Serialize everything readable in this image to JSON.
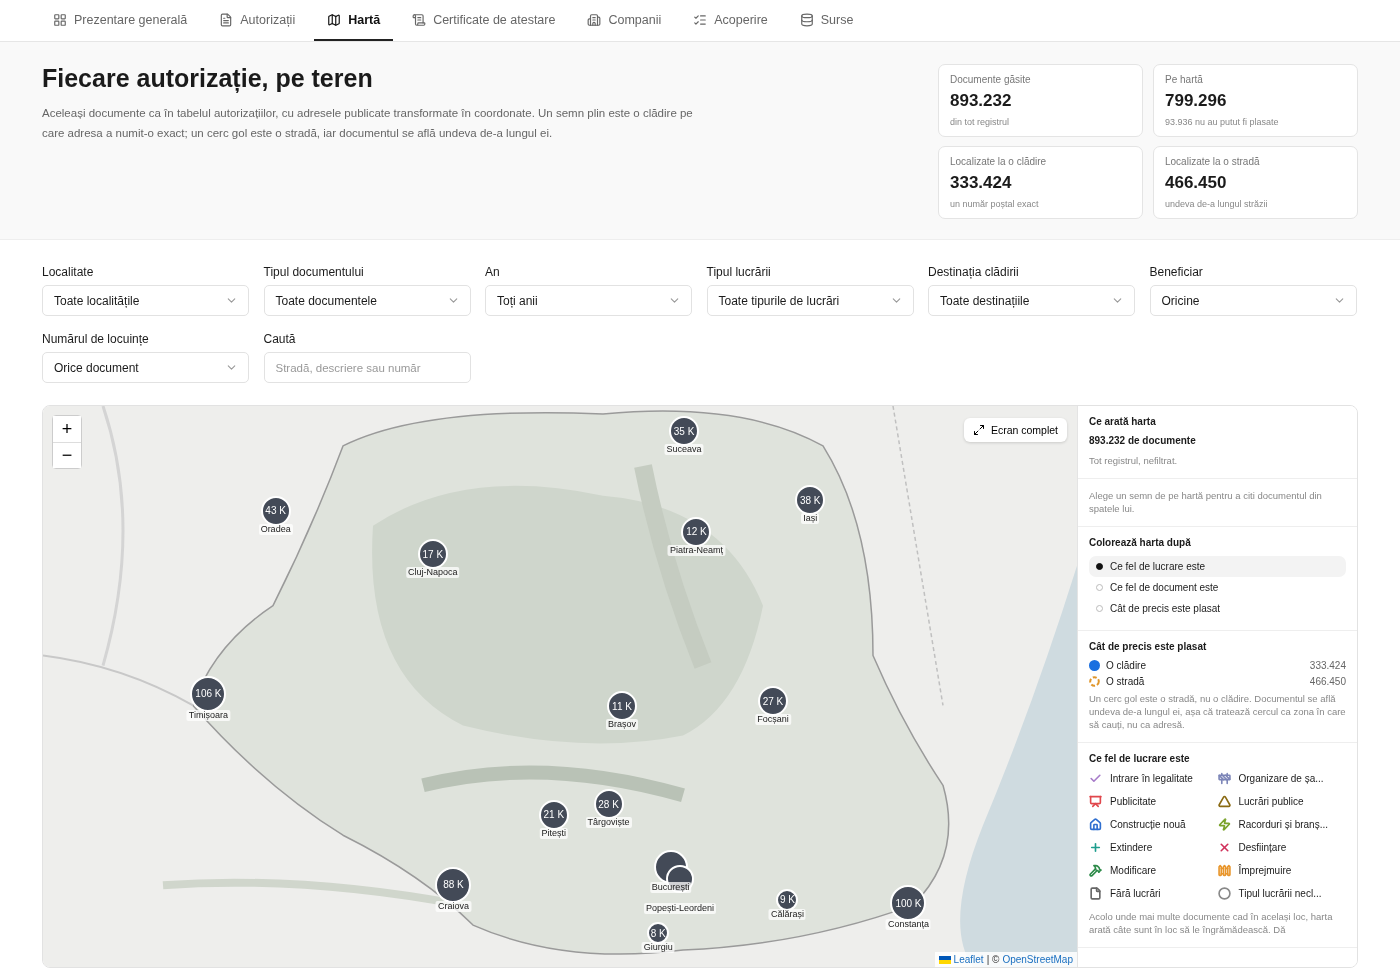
{
  "nav": [
    {
      "label": "Prezentare generală",
      "selected": false
    },
    {
      "label": "Autorizații",
      "selected": false
    },
    {
      "label": "Hartă",
      "selected": true
    },
    {
      "label": "Certificate de atestare",
      "selected": false
    },
    {
      "label": "Companii",
      "selected": false
    },
    {
      "label": "Acoperire",
      "selected": false
    },
    {
      "label": "Surse",
      "selected": false
    }
  ],
  "header": {
    "title": "Fiecare autorizație, pe teren",
    "description": "Aceleași documente ca în tabelul autorizațiilor, cu adresele publicate transformate în coordonate. Un semn plin este o clădire pe care adresa a numit-o exact; un cerc gol este o stradă, iar documentul se află undeva de-a lungul ei."
  },
  "stats": [
    {
      "label": "Documente găsite",
      "value": "893.232",
      "note": "din tot registrul"
    },
    {
      "label": "Pe hartă",
      "value": "799.296",
      "note": "93.936 nu au putut fi plasate"
    },
    {
      "label": "Localizate la o clădire",
      "value": "333.424",
      "note": "un număr poștal exact"
    },
    {
      "label": "Localizate la o stradă",
      "value": "466.450",
      "note": "undeva de-a lungul străzii"
    }
  ],
  "filters": [
    {
      "kind": "select",
      "label": "Localitate",
      "value": "Toate localitățile"
    },
    {
      "kind": "select",
      "label": "Tipul documentului",
      "value": "Toate documentele"
    },
    {
      "kind": "select",
      "label": "An",
      "value": "Toți anii"
    },
    {
      "kind": "select",
      "label": "Tipul lucrării",
      "value": "Toate tipurile de lucrări"
    },
    {
      "kind": "select",
      "label": "Destinația clădirii",
      "value": "Toate destinațiile"
    },
    {
      "kind": "select",
      "label": "Beneficiar",
      "value": "Oricine"
    },
    {
      "kind": "select",
      "label": "Numărul de locuințe",
      "value": "Orice document"
    },
    {
      "kind": "search",
      "label": "Caută",
      "placeholder": "Stradă, descriere sau număr"
    }
  ],
  "map": {
    "zoom_in": "+",
    "zoom_out": "−",
    "fullscreen": "Ecran complet",
    "attribution_leaflet": "Leaflet",
    "attribution_sep": "| ©",
    "attribution_osm": "OpenStreetMap",
    "clusters": [
      {
        "count": "35 K",
        "city": "Suceava"
      },
      {
        "count": "38 K",
        "city": "Iași"
      },
      {
        "count": "43 K",
        "city": "Oradea"
      },
      {
        "count": "17 K",
        "city": "Cluj-Napoca"
      },
      {
        "count": "12 K",
        "city": "Piatra-Neamț"
      },
      {
        "count": "106 K",
        "city": "Timișoara"
      },
      {
        "count": "11 K",
        "city": "Brașov"
      },
      {
        "count": "27 K",
        "city": "Focșani"
      },
      {
        "count": "21 K",
        "city": "Pitești"
      },
      {
        "count": "28 K",
        "city": "Târgoviște"
      },
      {
        "count": "88 K",
        "city": "Craiova"
      },
      {
        "city": "București"
      },
      {
        "city": "Popești-Leordeni"
      },
      {
        "count": "9 K",
        "city": "Călărași"
      },
      {
        "count": "100 K",
        "city": "Constanța"
      },
      {
        "count": "8 K",
        "city": "Giurgiu"
      }
    ]
  },
  "panel": {
    "title": "Ce arată harta",
    "count": "893.232 de documente",
    "scope": "Tot registrul, nefiltrat.",
    "hint": "Alege un semn de pe hartă pentru a citi documentul din spatele lui.",
    "color_by": {
      "title": "Colorează harta după",
      "options": [
        {
          "label": "Ce fel de lucrare este",
          "selected": true
        },
        {
          "label": "Ce fel de document este",
          "selected": false
        },
        {
          "label": "Cât de precis este plasat",
          "selected": false
        }
      ]
    },
    "precision": {
      "title": "Cât de precis este plasat",
      "items": [
        {
          "kind": "filled",
          "label": "O clădire",
          "value": "333.424",
          "color": "#1a6fe0"
        },
        {
          "kind": "ring",
          "label": "O stradă",
          "value": "466.450",
          "color": "#e0962a"
        }
      ],
      "note": "Un cerc gol este o stradă, nu o clădire. Documentul se află undeva de-a lungul ei, așa că tratează cercul ca zona în care să cauți, nu ca adresă."
    },
    "work": {
      "title": "Ce fel de lucrare este",
      "items": [
        {
          "label": "Intrare în legalitate",
          "color": "#a77bc9"
        },
        {
          "label": "Organizare de șa...",
          "color": "#7d86b8"
        },
        {
          "label": "Publicitate",
          "color": "#e0474c"
        },
        {
          "label": "Lucrări publice",
          "color": "#8a6a12"
        },
        {
          "label": "Construcție nouă",
          "color": "#2f6fd0"
        },
        {
          "label": "Racorduri și branș...",
          "color": "#7aa32a"
        },
        {
          "label": "Extindere",
          "color": "#1e9e8e"
        },
        {
          "label": "Desființare",
          "color": "#d0305a"
        },
        {
          "label": "Modificare",
          "color": "#2e8b4a"
        },
        {
          "label": "Împrejmuire",
          "color": "#e8952a"
        },
        {
          "label": "Fără lucrări",
          "color": "#666666"
        },
        {
          "label": "Tipul lucrării necl...",
          "color": "#888888"
        }
      ],
      "note": "Acolo unde mai multe documente cad în același loc, harta arată câte sunt în loc să le îngrămădească. Dă"
    }
  }
}
